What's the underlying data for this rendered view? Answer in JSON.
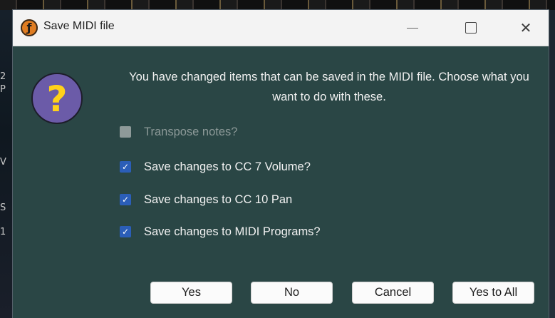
{
  "window": {
    "title": "Save MIDI file",
    "app_icon_glyph": "ƒ"
  },
  "window_controls": {
    "close_glyph": "✕"
  },
  "dialog": {
    "icon_glyph": "?",
    "message": "You have changed items that can be saved in the MIDI file. Choose what you want to do with these."
  },
  "options": [
    {
      "label": "Transpose notes?",
      "checked": false,
      "enabled": false
    },
    {
      "label": "Save changes to CC 7 Volume?",
      "checked": true,
      "enabled": true
    },
    {
      "label": "Save changes to CC 10 Pan",
      "checked": true,
      "enabled": true
    },
    {
      "label": "Save changes to MIDI Programs?",
      "checked": true,
      "enabled": true
    }
  ],
  "buttons": {
    "yes": "Yes",
    "no": "No",
    "cancel": "Cancel",
    "yes_to_all": "Yes to All"
  },
  "checkmark_glyph": "✓",
  "background_marks": [
    "2",
    "P",
    "V",
    "S",
    "1"
  ],
  "colors": {
    "dialog_bg": "#2a4645",
    "checkbox_checked": "#2b5eb8",
    "question_icon_bg": "#6b5ba8",
    "question_mark": "#ffd11a"
  }
}
